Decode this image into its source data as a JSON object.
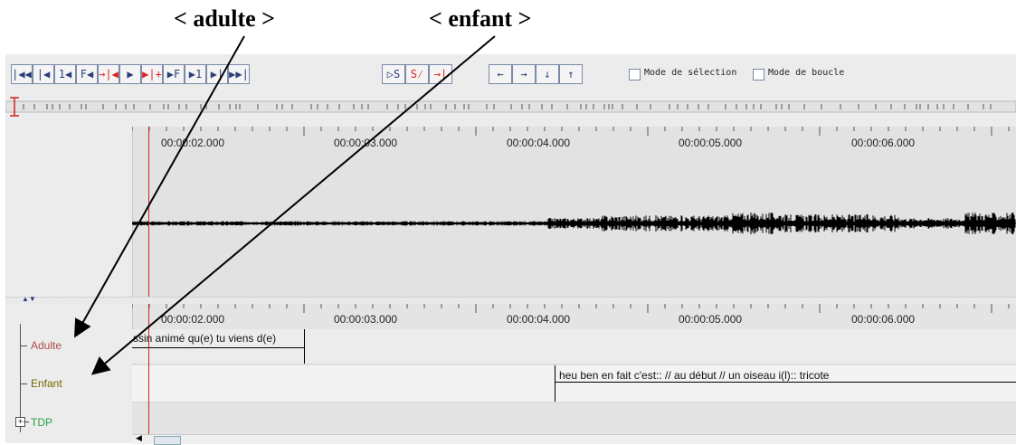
{
  "callouts": {
    "adulte": "< adulte >",
    "enfant": "< enfant >"
  },
  "toolbar": {
    "nav_buttons": [
      {
        "label": "|◀◀"
      },
      {
        "label": "|◀"
      },
      {
        "label": "1◀"
      },
      {
        "label": "F◀"
      },
      {
        "label": "→|◀"
      },
      {
        "label": "▶"
      },
      {
        "label": "▶|+"
      },
      {
        "label": "▶F"
      },
      {
        "label": "▶1"
      },
      {
        "label": "▶|"
      },
      {
        "label": "▶▶|"
      }
    ],
    "selection_buttons": [
      {
        "label": "▷S"
      },
      {
        "label": "S⁄"
      },
      {
        "label": "→|"
      }
    ],
    "arrow_buttons": [
      {
        "label": "←"
      },
      {
        "label": "→"
      },
      {
        "label": "↓"
      },
      {
        "label": "↑"
      }
    ],
    "mode_selection_label": "Mode de sélection",
    "mode_boucle_label": "Mode de boucle"
  },
  "timeline": {
    "ticks": [
      "00:00:02.000",
      "00:00:03.000",
      "00:00:04.000",
      "00:00:05.000",
      "00:00:06.000"
    ]
  },
  "tiers": [
    {
      "name": "Adulte",
      "color": "#b04a4a"
    },
    {
      "name": "Enfant",
      "color": "#6b6b00"
    },
    {
      "name": "TDP",
      "color": "#2aa04a"
    }
  ],
  "segments": {
    "adulte_text": "ssin animé qu(e) tu viens d(e)",
    "enfant_text": "heu ben en fait c'est:: // au début // un oiseau i(l):: tricote"
  },
  "colors": {
    "accent": "#2b3f7a",
    "crosshair": "#d22222"
  }
}
